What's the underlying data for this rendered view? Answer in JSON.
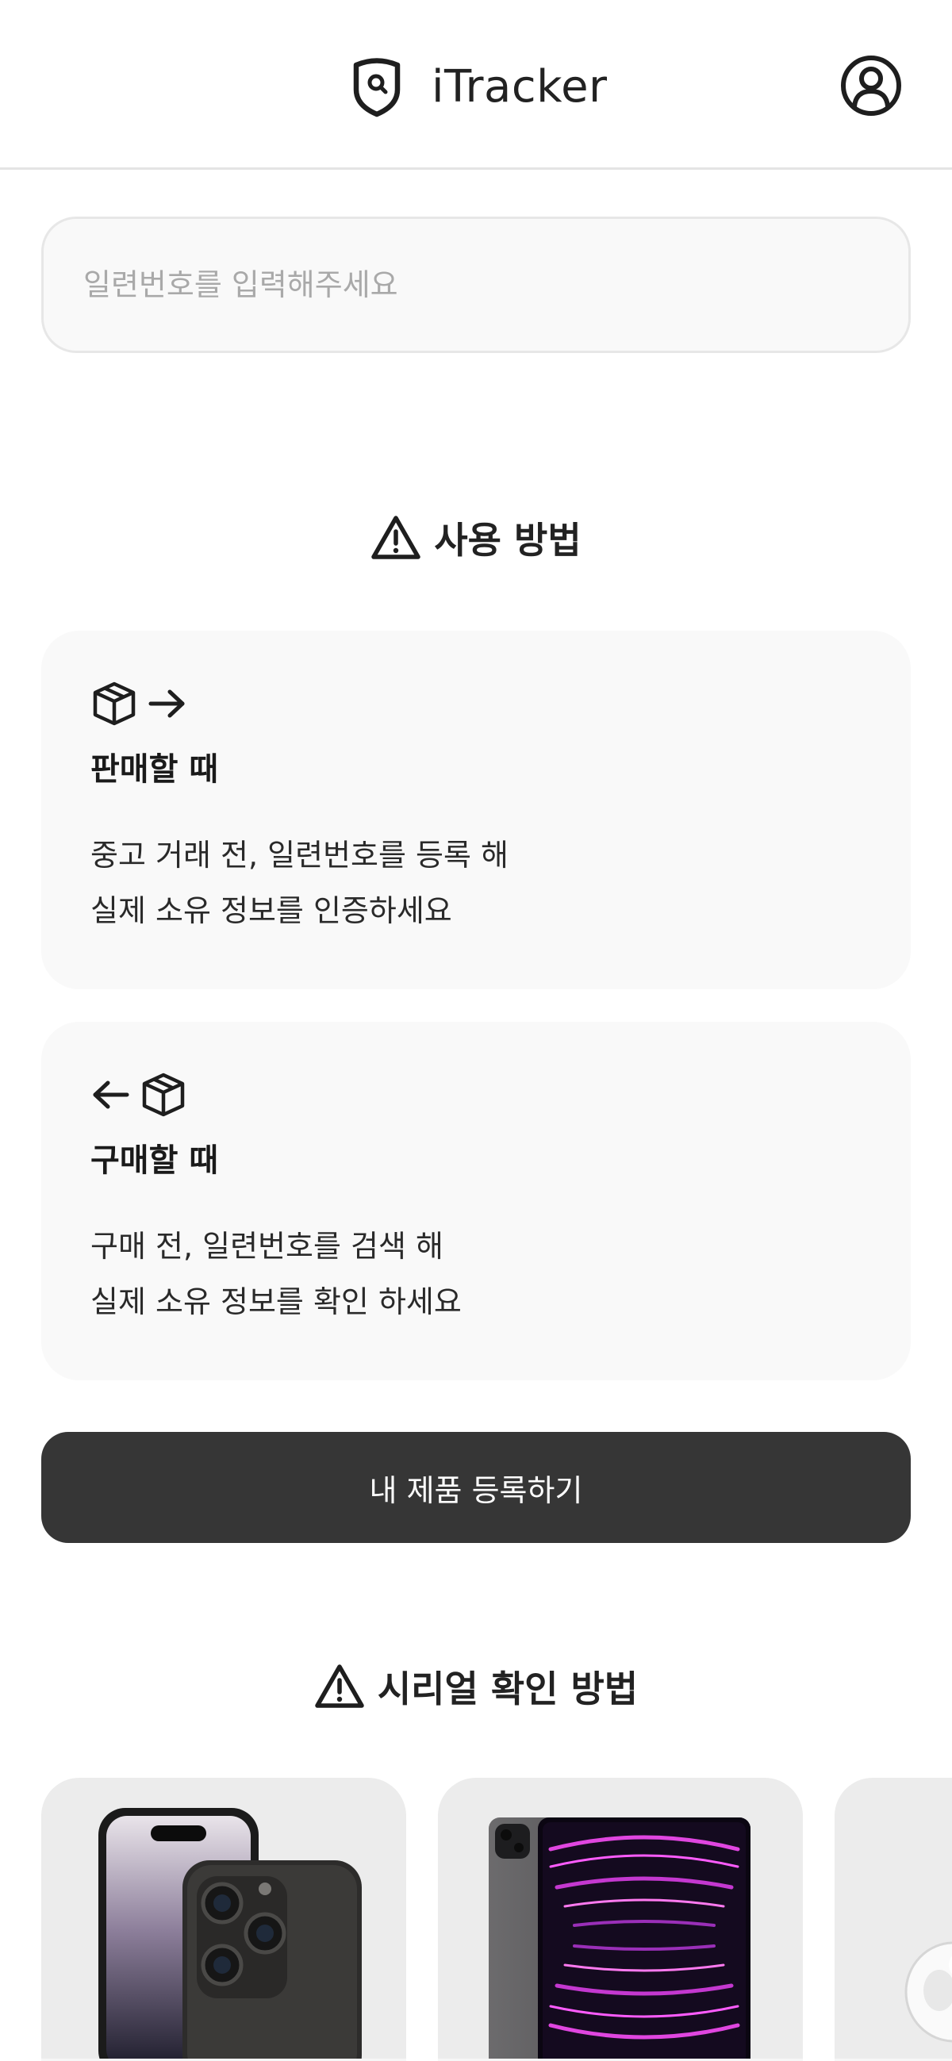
{
  "app": {
    "title": "iTracker"
  },
  "search": {
    "placeholder": "일련번호를 입력해주세요",
    "value": ""
  },
  "howto": {
    "title": "사용 방법",
    "cards": [
      {
        "title": "판매할 때",
        "lines": [
          "중고 거래 전, 일련번호를 등록 해",
          "실제 소유 정보를 인증하세요"
        ],
        "icons": [
          "box-icon",
          "arrow-right-icon"
        ]
      },
      {
        "title": "구매할 때",
        "lines": [
          "구매 전, 일련번호를 검색 해",
          "실제 소유 정보를 확인 하세요"
        ],
        "icons": [
          "arrow-left-icon",
          "box-icon"
        ]
      }
    ]
  },
  "register_button": {
    "label": "내 제품 등록하기"
  },
  "serial_check": {
    "title": "시리얼 확인 방법",
    "products": [
      {
        "image": "iphone-pro-image"
      },
      {
        "image": "ipad-pro-image"
      },
      {
        "image": "airpods-image"
      }
    ]
  },
  "colors": {
    "button_bg": "#363636",
    "card_bg": "#f9f9f9",
    "product_card_bg": "#ececec",
    "placeholder": "#a9a9a9"
  }
}
